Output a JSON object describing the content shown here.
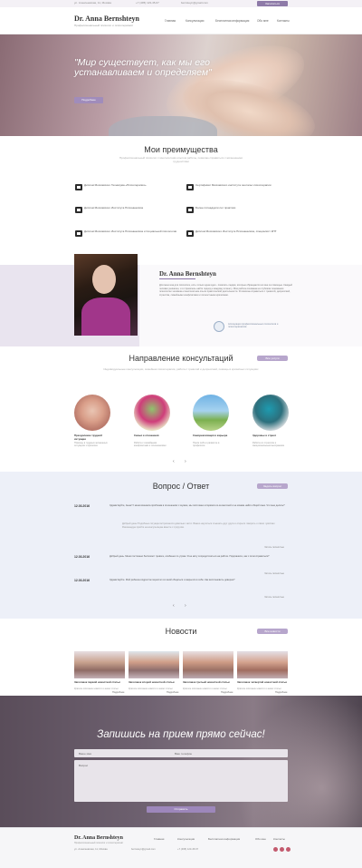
{
  "topbar": {
    "address": "ул. Алексеевская, 11, Москва",
    "phone_small": "+7 (495) 123-45-67",
    "email": "bernsteyn@gmail.com",
    "button": "Записаться"
  },
  "header": {
    "logo_name": "Dr. Anna Bernshteyn",
    "logo_sub": "Профессиональный психолог и психотерапевт",
    "nav": [
      "Главная",
      "Консультации",
      "Бесплатная информация",
      "Обо мне",
      "Контакты"
    ],
    "phone": "+7 (495) 123-45-67"
  },
  "hero": {
    "quote": "\"Мир существует, как мы его устанавливаем и определяем\"",
    "button": "Подробнее",
    "slides": 4,
    "active_slide": 1
  },
  "advantages": {
    "title": "Мои преимущества",
    "subtitle": "Профессиональный психолог с многолетним опытом работы, помогаю справиться с жизненными трудностями",
    "items": [
      "Диплом Московского Техникума «Психотерапия»",
      "Сертификат Московского института гештальт-психотерапии",
      "Диплом Московского Института Психоанализа",
      "Более пятнадцати лет практики",
      "Диплом Московского Института Психоанализа и Социальной психологии",
      "Диплом Московского Института Психоанализа, специалист КПТ"
    ]
  },
  "about": {
    "name": "Dr. Anna Bernshteyn",
    "text": "Для меня как для психолога, есть только одна идея - помогать людям, которые обращаются ко мне за помощью. Каждый человек уникален, и я стремлюсь найти подход к каждому клиенту. Моя работа основана на глубоком понимании психологии человека и многолетнем опыте практической деятельности. Я помогаю справиться с тревогой, депрессией, стрессом, семейными конфликтами и личностными кризисами.",
    "seal_text": "Ассоциация профессиональных психологов и психотерапевтов"
  },
  "consult": {
    "title": "Направление консультаций",
    "button": "Все услуги",
    "subtitle": "Индивидуальные консультации, семейная психотерапия, работа с тревогой и депрессией, помощь в кризисных ситуациях",
    "items": [
      {
        "title": "Преодоление трудной ситуации",
        "text": "Помощь в трудных жизненных ситуациях и кризисах"
      },
      {
        "title": "Семья и отношения",
        "text": "Работа с семейными конфликтами и отношениями"
      },
      {
        "title": "Самореализация и карьера",
        "text": "Поиск себя и развитие в профессии"
      },
      {
        "title": "Здоровье и стресс",
        "text": "Работа со стрессом и эмоциональным выгоранием"
      }
    ]
  },
  "faq": {
    "title": "Вопрос / Ответ",
    "button": "Задать вопрос",
    "items": [
      {
        "date": "12.03.2016",
        "question": "Здравствуйте, Анна! У меня возникла проблема в отношениях с мужем, мы постоянно ссоримся из-за мелочей и не можем найти общий язык. Что мне делать?",
        "answer": "Добрый день! Подобные ситуации встречаются довольно часто. Важно научиться слышать друг друга и открыто говорить о своих чувствах. Рекомендую прийти на консультацию вместе с супругом.",
        "more": "Читать полностью"
      },
      {
        "date": "12.03.2016",
        "question": "Добрый день. Меня постоянно беспокоит тревога, особенно по утрам. Я не могу сосредоточиться на работе. Подскажите, как с этим справиться?",
        "more": "Читать полностью"
      },
      {
        "date": "12.03.2016",
        "question": "Здравствуйте. Мой ребенок-подросток перестал со мной общаться и закрылся в себе. Как восстановить доверие?",
        "more": "Читать полностью"
      }
    ]
  },
  "news": {
    "title": "Новости",
    "button": "Все новости",
    "items": [
      {
        "title": "Заголовок первой новостной статьи",
        "text": "Краткое описание новости и анонс статьи",
        "more": "Подробнее"
      },
      {
        "title": "Заголовок второй новостной статьи",
        "text": "Краткое описание новости и анонс статьи",
        "more": "Подробнее"
      },
      {
        "title": "Заголовок третьей новостной статьи",
        "text": "Краткое описание новости и анонс статьи",
        "more": "Подробнее"
      },
      {
        "title": "Заголовок четвертой новостной статьи",
        "text": "Краткое описание новости и анонс статьи",
        "more": "Подробнее"
      }
    ]
  },
  "booking": {
    "title": "Запишись на прием прямо сейчас!",
    "name_placeholder": "Ваше имя",
    "phone_placeholder": "Ваш телефон",
    "question_placeholder": "Вопрос",
    "send": "Отправить"
  },
  "footer": {
    "name": "Dr. Anna Bernshteyn",
    "sub": "Профессиональный психолог и психотерапевт",
    "nav": [
      "Главная",
      "Консультации",
      "Бесплатная информация",
      "Обо мне",
      "Контакты"
    ],
    "address": "ул. Алексеевская, 11, Москва",
    "email": "bernsteyn@gmail.com",
    "phone": "+7 (495) 123-45-67"
  }
}
